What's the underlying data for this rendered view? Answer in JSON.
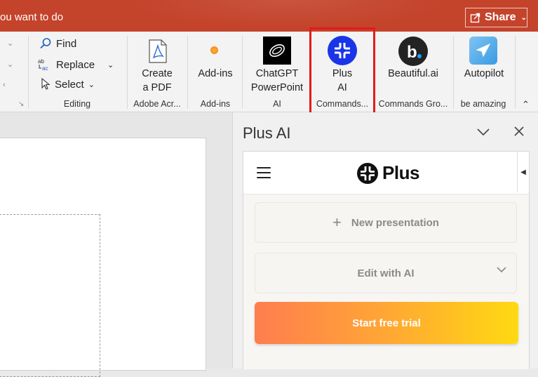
{
  "titlebar": {
    "search_text": "ou want to do",
    "share_label": "Share"
  },
  "ribbon": {
    "editing": {
      "find_label": "Find",
      "replace_label": "Replace",
      "select_label": "Select",
      "group_label": "Editing"
    },
    "buttons": [
      {
        "label_line1": "Create",
        "label_line2": "a PDF",
        "group": "Adobe Acr..."
      },
      {
        "label_line1": "Add-ins",
        "label_line2": "",
        "group": "Add-ins"
      },
      {
        "label_line1": "ChatGPT",
        "label_line2": "PowerPoint",
        "group": "AI"
      },
      {
        "label_line1": "Plus",
        "label_line2": "AI",
        "group": "Commands..."
      },
      {
        "label_line1": "Beautiful.ai",
        "label_line2": "",
        "group": "Commands Gro..."
      },
      {
        "label_line1": "Autopilot",
        "label_line2": "",
        "group": "be amazing"
      }
    ]
  },
  "pane": {
    "title": "Plus AI",
    "logo_text": "Plus",
    "new_presentation_label": "New presentation",
    "edit_with_ai_label": "Edit with AI",
    "start_trial_label": "Start free trial"
  },
  "colors": {
    "titlebar": "#c4432b",
    "highlight": "#e31b1b",
    "plus_blue": "#1a35e8",
    "trial_gradient_start": "#ff7d4f",
    "trial_gradient_end": "#ffd912"
  }
}
